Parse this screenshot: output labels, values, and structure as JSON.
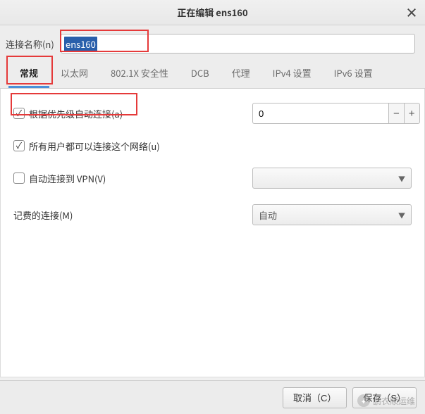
{
  "title": "正在编辑 ens160",
  "name_label": "连接名称(n)",
  "name_value": "ens160",
  "tabs": {
    "general": "常规",
    "ethernet": "以太网",
    "security": "802.1X 安全性",
    "dcb": "DCB",
    "proxy": "代理",
    "ipv4": "IPv4 设置",
    "ipv6": "IPv6 设置"
  },
  "general": {
    "auto_connect_label": "根据优先级自动连接(a)",
    "priority_value": "0",
    "all_users_label": "所有用户都可以连接这个网络(u)",
    "vpn_label": "自动连接到 VPN(V)",
    "metered_label": "记费的连接(M)",
    "metered_value": "自动"
  },
  "footer": {
    "cancel": "取消（C）",
    "save": "保存（S）"
  },
  "watermark": "鹏衣顺运维"
}
